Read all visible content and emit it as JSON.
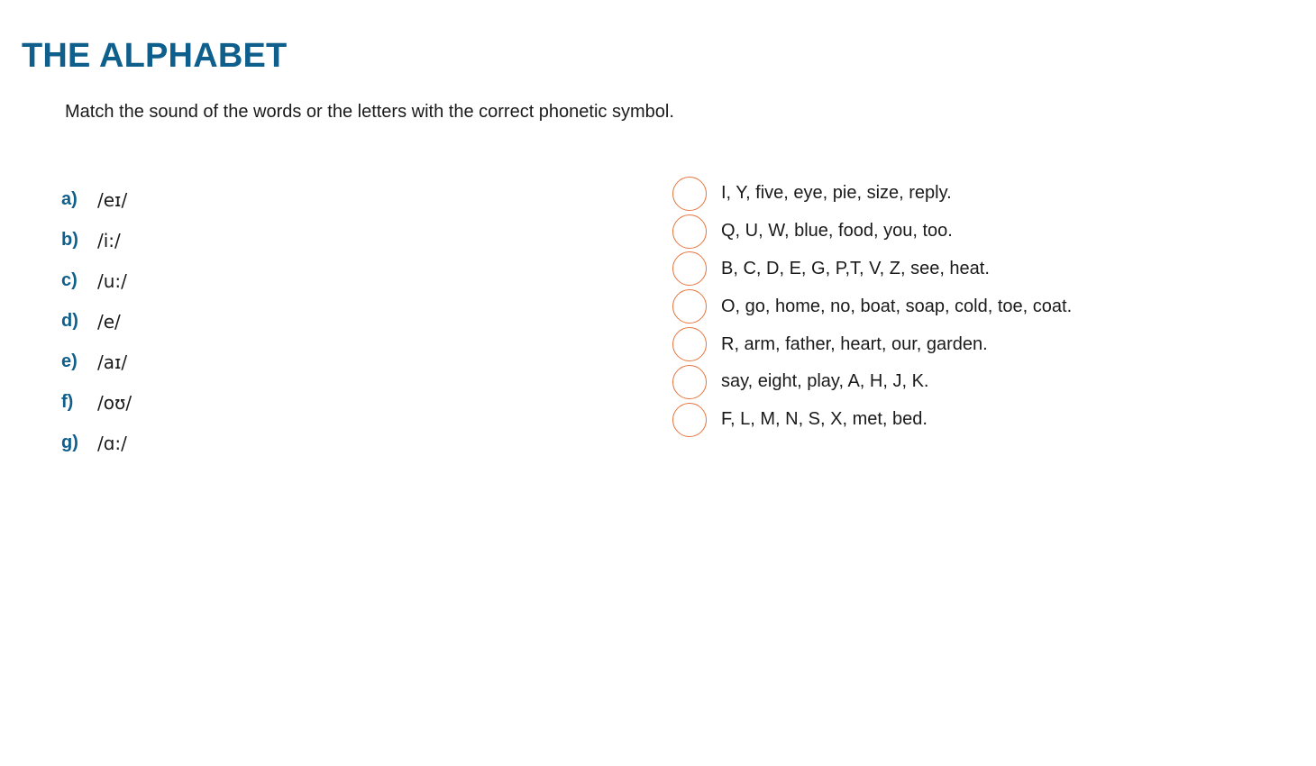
{
  "title": "THE ALPHABET",
  "instruction": "Match the sound of the words or the letters with the correct phonetic symbol.",
  "symbols": [
    {
      "letter": "a)",
      "ipa": "/eɪ/"
    },
    {
      "letter": "b)",
      "ipa": "/i:/"
    },
    {
      "letter": "c)",
      "ipa": "/u:/"
    },
    {
      "letter": "d)",
      "ipa": "/e/"
    },
    {
      "letter": "e)",
      "ipa": "/aɪ/"
    },
    {
      "letter": "f)",
      "ipa": "/oʊ/"
    },
    {
      "letter": "g)",
      "ipa": "/ɑ:/"
    }
  ],
  "matches": [
    {
      "answer": "",
      "text": "I, Y, five, eye, pie, size, reply."
    },
    {
      "answer": "",
      "text": "Q, U, W, blue, food, you, too."
    },
    {
      "answer": "",
      "text": "B, C, D, E, G, P,T, V, Z, see, heat."
    },
    {
      "answer": "",
      "text": "O, go, home, no, boat, soap, cold, toe, coat."
    },
    {
      "answer": "",
      "text": "R, arm, father, heart, our, garden."
    },
    {
      "answer": "",
      "text": "say, eight, play, A, H, J, K."
    },
    {
      "answer": "",
      "text": "F, L, M, N, S, X, met, bed."
    }
  ],
  "colors": {
    "title": "#0f5f8c",
    "letter": "#0f5f8c",
    "circle_border": "#e4753f",
    "text": "#1a1a1a"
  }
}
